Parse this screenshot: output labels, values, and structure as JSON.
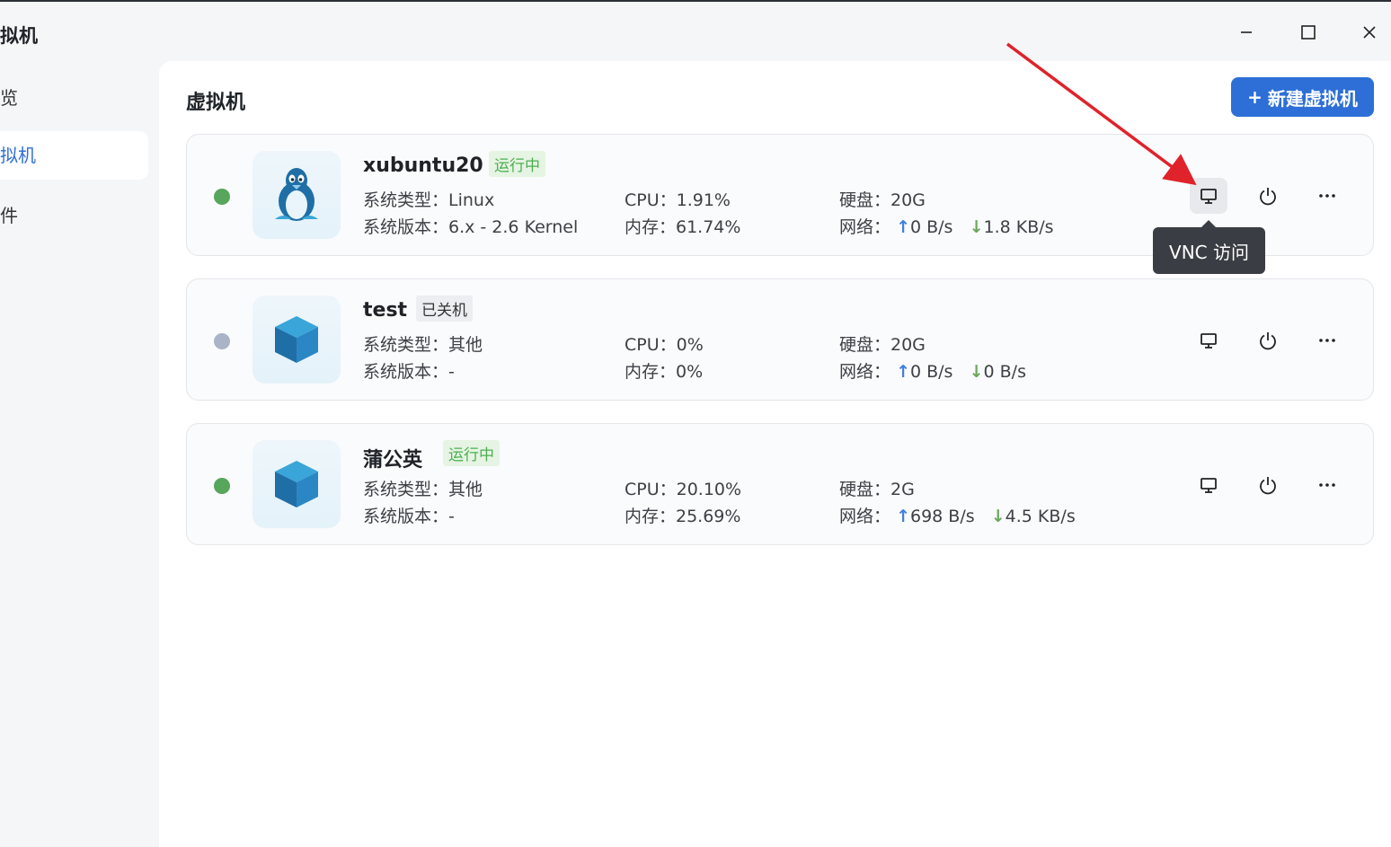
{
  "window": {
    "title": "拟机",
    "controls": [
      "minimize",
      "maximize",
      "close"
    ]
  },
  "sidebar": {
    "items": [
      {
        "label": "览",
        "active": false
      },
      {
        "label": "拟机",
        "active": true
      },
      {
        "label": "件",
        "active": false
      }
    ]
  },
  "main": {
    "title": "虚拟机",
    "new_button": {
      "icon": "+",
      "label": "新建虚拟机"
    }
  },
  "vms": [
    {
      "name": "xubuntu20",
      "status": "运行中",
      "running": true,
      "icon": "linux-penguin-icon",
      "type_label": "系统类型：Linux",
      "version_label": "系统版本：6.x - 2.6 Kernel",
      "cpu_label": "CPU：1.91%",
      "mem_label": "内存：61.74%",
      "disk_label": "硬盘：20G",
      "net_prefix": "网络：",
      "net_up": "0 B/s",
      "net_down": "1.8 KB/s"
    },
    {
      "name": "test",
      "status": "已关机",
      "running": false,
      "icon": "cube-icon",
      "type_label": "系统类型：其他",
      "version_label": "系统版本：-",
      "cpu_label": "CPU：0%",
      "mem_label": "内存：0%",
      "disk_label": "硬盘：20G",
      "net_prefix": "网络：",
      "net_up": "0 B/s",
      "net_down": "0 B/s"
    },
    {
      "name": "蒲公英",
      "status": "运行中",
      "running": true,
      "icon": "cube-icon",
      "type_label": "系统类型：其他",
      "version_label": "系统版本：-",
      "cpu_label": "CPU：20.10%",
      "mem_label": "内存：25.69%",
      "disk_label": "硬盘：2G",
      "net_prefix": "网络：",
      "net_up": "698 B/s",
      "net_down": "4.5 KB/s"
    }
  ],
  "tooltip": "VNC 访问",
  "colors": {
    "accent": "#2d6fd6",
    "running_dot": "#58a55c",
    "stopped_dot": "#a9b4c6",
    "running_badge_bg": "#e6f4e3",
    "running_badge_text": "#4caf50",
    "stopped_badge_bg": "#eceef1",
    "annotation_arrow": "#e0222a"
  }
}
